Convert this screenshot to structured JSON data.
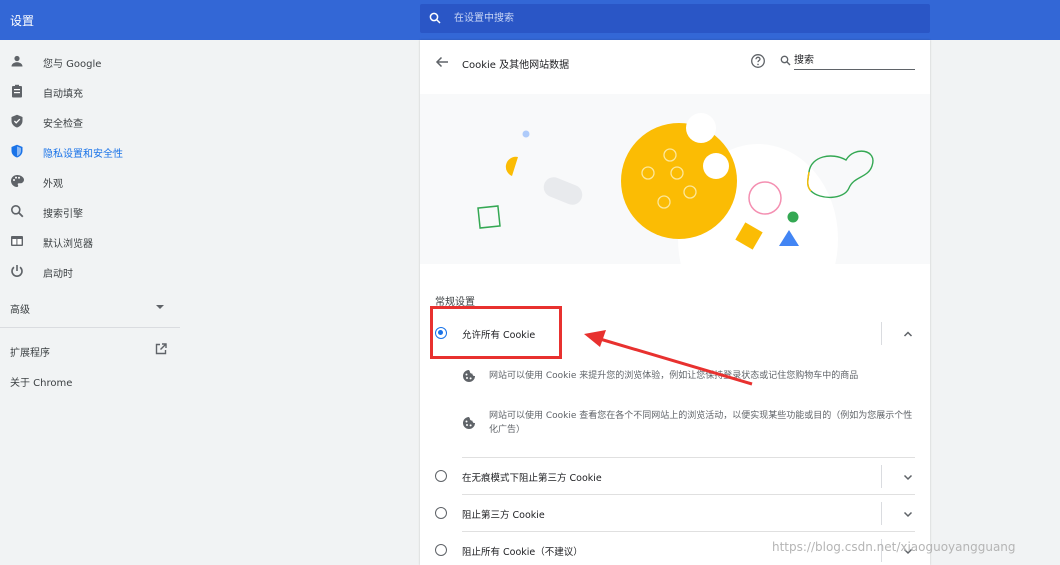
{
  "header": {
    "title": "设置",
    "search_placeholder": "在设置中搜索"
  },
  "sidebar": {
    "items": [
      {
        "label": "您与 Google",
        "icon": "person-icon"
      },
      {
        "label": "自动填充",
        "icon": "clipboard-icon"
      },
      {
        "label": "安全检查",
        "icon": "shield-check-icon"
      },
      {
        "label": "隐私设置和安全性",
        "icon": "privacy-shield-icon",
        "active": true
      },
      {
        "label": "外观",
        "icon": "palette-icon"
      },
      {
        "label": "搜索引擎",
        "icon": "search-icon"
      },
      {
        "label": "默认浏览器",
        "icon": "browser-icon"
      },
      {
        "label": "启动时",
        "icon": "power-icon"
      }
    ],
    "advanced_label": "高级",
    "extensions_label": "扩展程序",
    "about_label": "关于 Chrome"
  },
  "page": {
    "title": "Cookie 及其他网站数据",
    "search_placeholder": "搜索",
    "section_label": "常规设置",
    "options": [
      {
        "label": "允许所有 Cookie",
        "selected": true,
        "expanded": true
      },
      {
        "label": "在无痕模式下阻止第三方 Cookie",
        "selected": false,
        "expanded": false
      },
      {
        "label": "阻止第三方 Cookie",
        "selected": false,
        "expanded": false
      },
      {
        "label": "阻止所有 Cookie（不建议）",
        "selected": false,
        "expanded": false
      }
    ],
    "details": [
      "网站可以使用 Cookie 来提升您的浏览体验，例如让您保持登录状态或记住您购物车中的商品",
      "网站可以使用 Cookie 查看您在各个不同网站上的浏览活动，以便实现某些功能或目的（例如为您展示个性化广告）"
    ]
  },
  "annotation": {
    "highlight_color": "#e8312f"
  },
  "watermark": "https://blog.csdn.net/xiaoguoyangguang",
  "colors": {
    "header_bg": "#3367d6",
    "accent": "#1a73e8",
    "cookie_yellow": "#fbbc04"
  }
}
